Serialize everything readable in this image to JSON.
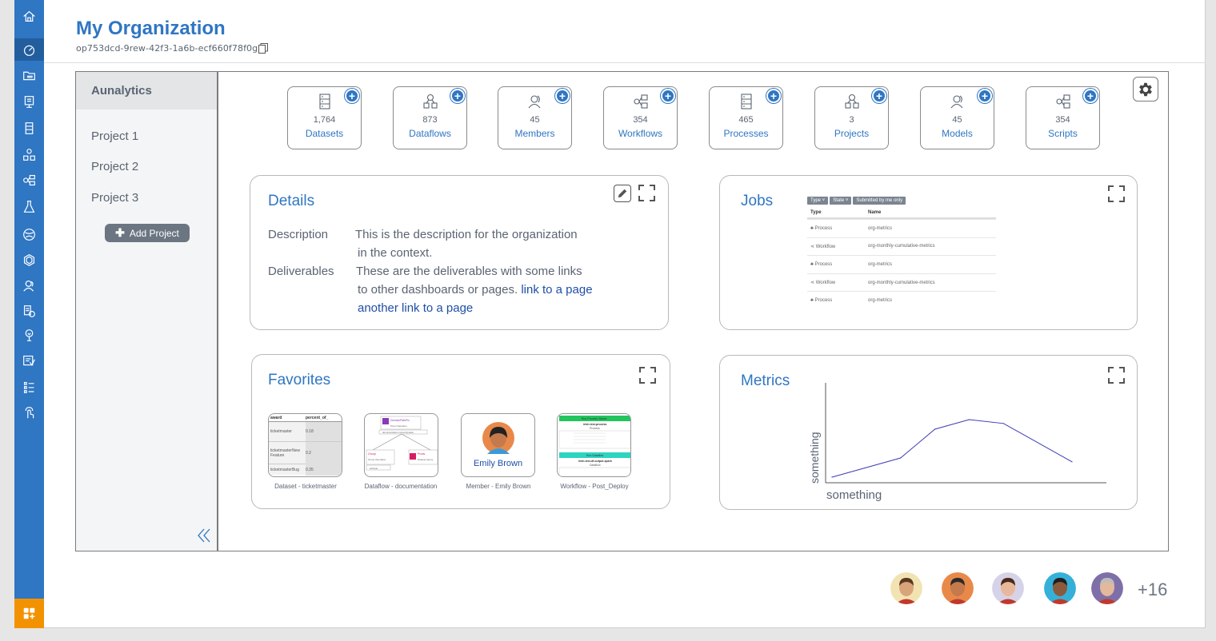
{
  "organization": {
    "title": "My Organization",
    "id": "op753dcd-9rew-42f3-1a6b-ecf660f78f0g"
  },
  "rail": {
    "icons": [
      "home-icon",
      "dashboard-icon",
      "folder-icon",
      "monitor-icon",
      "datasets-icon",
      "dataflow-icon",
      "workflow-icon",
      "lab-icon",
      "globe-icon",
      "hexagon-icon",
      "members-icon",
      "process-icon",
      "tree-icon",
      "shield-icon",
      "list-icon",
      "touch-icon"
    ],
    "bottom_icon": "apps-add-icon",
    "bottom_color": "#f39200",
    "color": "#2f76c3"
  },
  "sidebar": {
    "heading": "Aunalytics",
    "projects": [
      "Project 1",
      "Project 2",
      "Project 3"
    ],
    "add_label": "Add Project"
  },
  "stats": [
    {
      "count": "1,764",
      "label": "Datasets",
      "icon": "datasets-icon"
    },
    {
      "count": "873",
      "label": "Dataflows",
      "icon": "dataflow-icon"
    },
    {
      "count": "45",
      "label": "Members",
      "icon": "members-icon"
    },
    {
      "count": "354",
      "label": "Workflows",
      "icon": "workflow-icon"
    },
    {
      "count": "465",
      "label": "Processes",
      "icon": "datasets-icon"
    },
    {
      "count": "3",
      "label": "Projects",
      "icon": "dataflow-icon"
    },
    {
      "count": "45",
      "label": "Models",
      "icon": "members-icon"
    },
    {
      "count": "354",
      "label": "Scripts",
      "icon": "workflow-icon"
    }
  ],
  "details": {
    "title": "Details",
    "description_label": "Description",
    "description_line1": "This is the description for the organization",
    "description_line2": "in the context.",
    "deliverables_label": "Deliverables",
    "deliverables_line1": "These are the deliverables with some links",
    "deliverables_line2": "to other dashboards or pages.",
    "link1": "link to a page",
    "link2": "another link to a page"
  },
  "jobs": {
    "title": "Jobs",
    "filters": [
      "Type ˅",
      "State ˅",
      "Submitted by me only"
    ],
    "col_type": "Type",
    "col_name": "Name",
    "rows": [
      {
        "type": "Process",
        "name": "org-metrics"
      },
      {
        "type": "Workflow",
        "name": "org-monthly-cumulative-metrics"
      },
      {
        "type": "Process",
        "name": "org-metrics"
      },
      {
        "type": "Workflow",
        "name": "org-monthly-cumulative-metrics"
      },
      {
        "type": "Process",
        "name": "org-metrics"
      }
    ]
  },
  "favorites": {
    "title": "Favorites",
    "dataset": {
      "caption": "Dataset - ticketmaster",
      "headers": [
        "award",
        "percent_of_"
      ],
      "rows": [
        [
          "ticketmaster",
          "0.18"
        ],
        [
          "ticketmasterNew Feature",
          "0.2"
        ],
        [
          "ticketmasterBug",
          "0.35"
        ]
      ]
    },
    "dataflow": {
      "caption": "Dataflow - documentation",
      "node_top": "DomainPathFix",
      "node_top_sub": "Pivot Operation",
      "node_mid": "documentation.currently.data",
      "node_left": "Group",
      "node_left_sub": "Group Operation",
      "node_right": "Prods",
      "node_right_sub": "Dataset Query",
      "node_bottom": "activate"
    },
    "member": {
      "caption": "Member - Emily Brown",
      "name": "Emily Brown"
    },
    "workflow": {
      "caption": "Workflow - Post_Deploy",
      "top_bar": "Run Process Values",
      "top_name": "irish-test-process",
      "top_sub": "Process",
      "bottom_bar": "Run Dataflow",
      "bottom_name": "irish-test-df-output-spark",
      "bottom_sub": "Dataflow"
    }
  },
  "metrics": {
    "title": "Metrics"
  },
  "chart_data": {
    "type": "line",
    "title": "",
    "xlabel": "something",
    "ylabel": "something",
    "series": [
      {
        "values": [
          [
            0,
            0
          ],
          [
            20,
            10
          ],
          [
            30,
            25
          ],
          [
            40,
            30
          ],
          [
            50,
            28
          ],
          [
            70,
            8
          ]
        ]
      }
    ],
    "grid": false
  },
  "team": {
    "more_count": "+16",
    "avatars": [
      {
        "skin": "#d9a47a",
        "hair": "#5a3a22",
        "bg": "#f2e3b3"
      },
      {
        "skin": "#c47a4c",
        "hair": "#2a2a2a",
        "bg": "#e8894a"
      },
      {
        "skin": "#e8b89a",
        "hair": "#4a2a1a",
        "bg": "#d6d3e8"
      },
      {
        "skin": "#8a5a3c",
        "hair": "#1f1f1f",
        "bg": "#35b0d8"
      },
      {
        "skin": "#e3b89c",
        "hair": "#bdbdbd",
        "bg": "#7f6fa8"
      }
    ]
  }
}
